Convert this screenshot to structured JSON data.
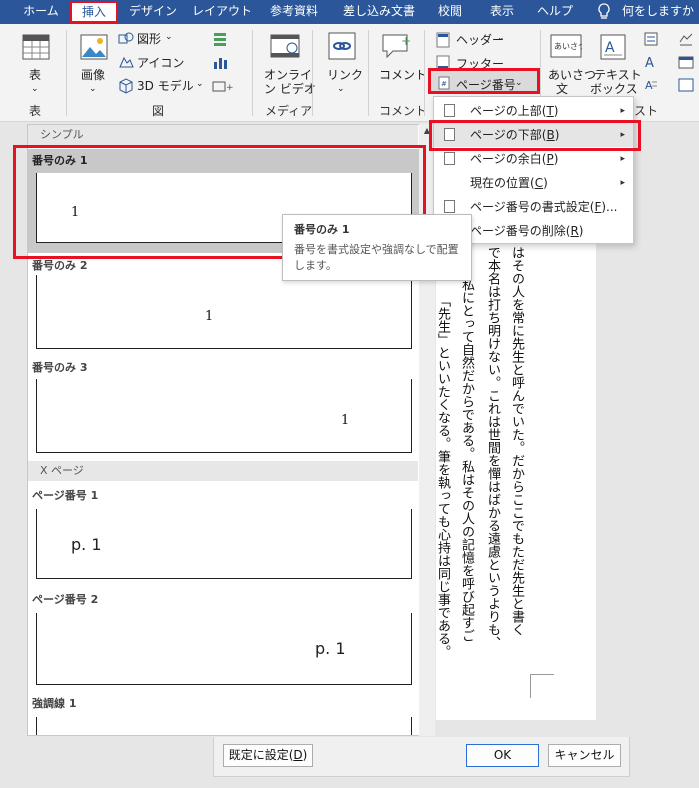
{
  "tabs": [
    "ホーム",
    "挿入",
    "デザイン",
    "レイアウト",
    "参考資料",
    "差し込み文書",
    "校閲",
    "表示",
    "ヘルプ"
  ],
  "tell_me": "何をしますか",
  "ribbon": {
    "table_label": "表",
    "image_label": "画像",
    "shapes_label": "図形",
    "icons_label": "アイコン",
    "model3d_label": "3D モデル",
    "online_video_label1": "オンライ",
    "online_video_label2": "ン ビデオ",
    "link_label": "リンク",
    "comment_label": "コメント",
    "header_label": "ヘッダー",
    "footer_label": "フッター",
    "page_number_label": "ページ番号",
    "greeting_label1": "あいさつ",
    "greeting_label2": "文",
    "textbox_label1": "テキスト",
    "textbox_label2": "ボックス",
    "groups": {
      "table": "表",
      "illustrations": "図",
      "media": "メディア",
      "comment": "コメント",
      "text": "スト"
    },
    "greeting_icon_text": "あいさつ"
  },
  "menu": {
    "items": [
      {
        "label": "ページの上部(",
        "key": "T",
        ")": ")",
        "has_sub": true
      },
      {
        "label": "ページの下部(",
        "key": "B",
        ")": ")",
        "has_sub": true
      },
      {
        "label": "ページの余白(",
        "key": "P",
        ")": ")",
        "has_sub": true
      },
      {
        "label": "現在の位置(",
        "key": "C",
        ")": ")",
        "has_sub": true
      },
      {
        "label": "ページ番号の書式設定(",
        "key": "F",
        ")": ")...",
        "has_sub": false
      },
      {
        "label": "ページ番号の削除(",
        "key": "R",
        ")": ")",
        "has_sub": false
      }
    ],
    "arrow": "▸"
  },
  "gallery": {
    "sections": [
      "シンプル",
      "X ページ"
    ],
    "items": [
      {
        "label": "番号のみ 1",
        "number": "1"
      },
      {
        "label": "番号のみ 2",
        "number": "1"
      },
      {
        "label": "番号のみ 3",
        "number": "1"
      },
      {
        "label": "ページ番号 1",
        "number": "p. 1"
      },
      {
        "label": "ページ番号 2",
        "number": "p. 1"
      },
      {
        "label": "強調線 1",
        "number": ""
      }
    ]
  },
  "tooltip": {
    "title": "番号のみ 1",
    "desc1": "番号を書式設定や強調なしで配置",
    "desc2": "します。"
  },
  "document": {
    "columns": [
      "はその人を常に先生と呼んでいた。だからここでもただ先生と書く",
      "で本名は打ち明けない。これは世間を憚はばかる遠慮というよりも、",
      "私にとって自然だからである。私はその人の記憶を呼び起すご",
      "「先生」といいたくなる。筆を執っても心持は同じ事である。"
    ]
  },
  "dialog": {
    "default_label": "既定に設定(",
    "default_key": "D",
    "default_close": ")",
    "ok_label": "OK",
    "cancel_label": "キャンセル"
  },
  "colors": {
    "ribbon_blue": "#2b579a",
    "highlight_red": "#e81123",
    "menu_hover": "#e5e5e5"
  }
}
